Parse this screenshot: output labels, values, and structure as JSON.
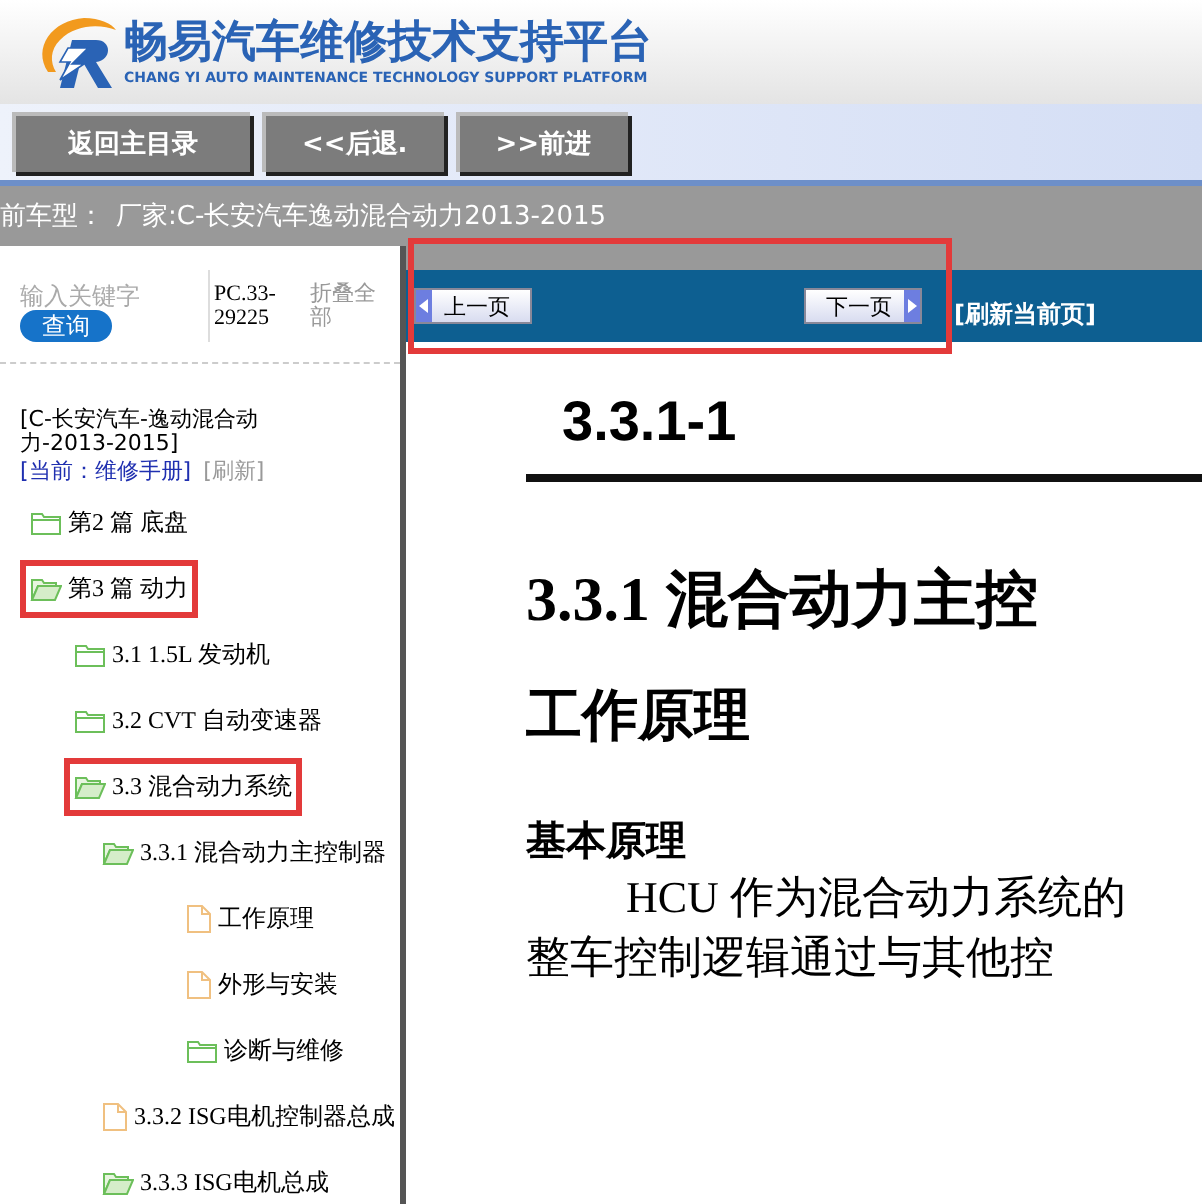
{
  "header": {
    "title": "畅易汽车维修技术支持平台",
    "subtitle": "CHANG YI AUTO MAINTENANCE TECHNOLOGY SUPPORT PLATFORM"
  },
  "nav_buttons": [
    "返回主目录",
    "<<后退.",
    ">>前进"
  ],
  "vehicle_bar": {
    "label": "前车型：",
    "value": "厂家:C-长安汽车逸动混合动力2013-2015"
  },
  "sidebar": {
    "search": {
      "placeholder": "输入关键字",
      "button": "查询"
    },
    "code": "PC.33-29225",
    "collapse_all": "折叠全部",
    "book": {
      "title": "[C-长安汽车-逸动混合动力-2013-2015]",
      "current": "[当前：维修手册]",
      "refresh": "[刷新]"
    },
    "tree": [
      {
        "label": "第2 篇 底盘",
        "kind": "folder",
        "expanded": false,
        "highlighted": false
      },
      {
        "label": "第3 篇 动力",
        "kind": "folder",
        "expanded": true,
        "highlighted": true,
        "children": [
          {
            "label": "3.1 1.5L 发动机",
            "kind": "folder",
            "expanded": false,
            "highlighted": false
          },
          {
            "label": "3.2 CVT 自动变速器",
            "kind": "folder",
            "expanded": false,
            "highlighted": false
          },
          {
            "label": "3.3 混合动力系统",
            "kind": "folder",
            "expanded": true,
            "highlighted": true,
            "children": [
              {
                "label": "3.3.1 混合动力主控制器",
                "kind": "folder",
                "expanded": true,
                "highlighted": false,
                "children": [
                  {
                    "label": "工作原理",
                    "kind": "document",
                    "highlighted": false
                  },
                  {
                    "label": "外形与安装",
                    "kind": "document",
                    "highlighted": false
                  },
                  {
                    "label": "诊断与维修",
                    "kind": "folder",
                    "expanded": false,
                    "highlighted": false
                  }
                ]
              },
              {
                "label": "3.3.2 ISG电机控制器总成",
                "kind": "document",
                "highlighted": false
              },
              {
                "label": "3.3.3 ISG电机总成",
                "kind": "folder",
                "expanded": true,
                "highlighted": false
              }
            ]
          }
        ]
      }
    ]
  },
  "toolbar": {
    "prev": "上一页",
    "next": "下一页",
    "refresh": "[刷新当前页]",
    "highlighted": true
  },
  "document": {
    "page_number": "3.3.1-1",
    "section_title": "3.3.1  混合动力主控",
    "heading": "工作原理",
    "subheading": "基本原理",
    "lines": [
      "HCU  作为混合动力系统的",
      "整车控制逻辑通过与其他控"
    ]
  }
}
